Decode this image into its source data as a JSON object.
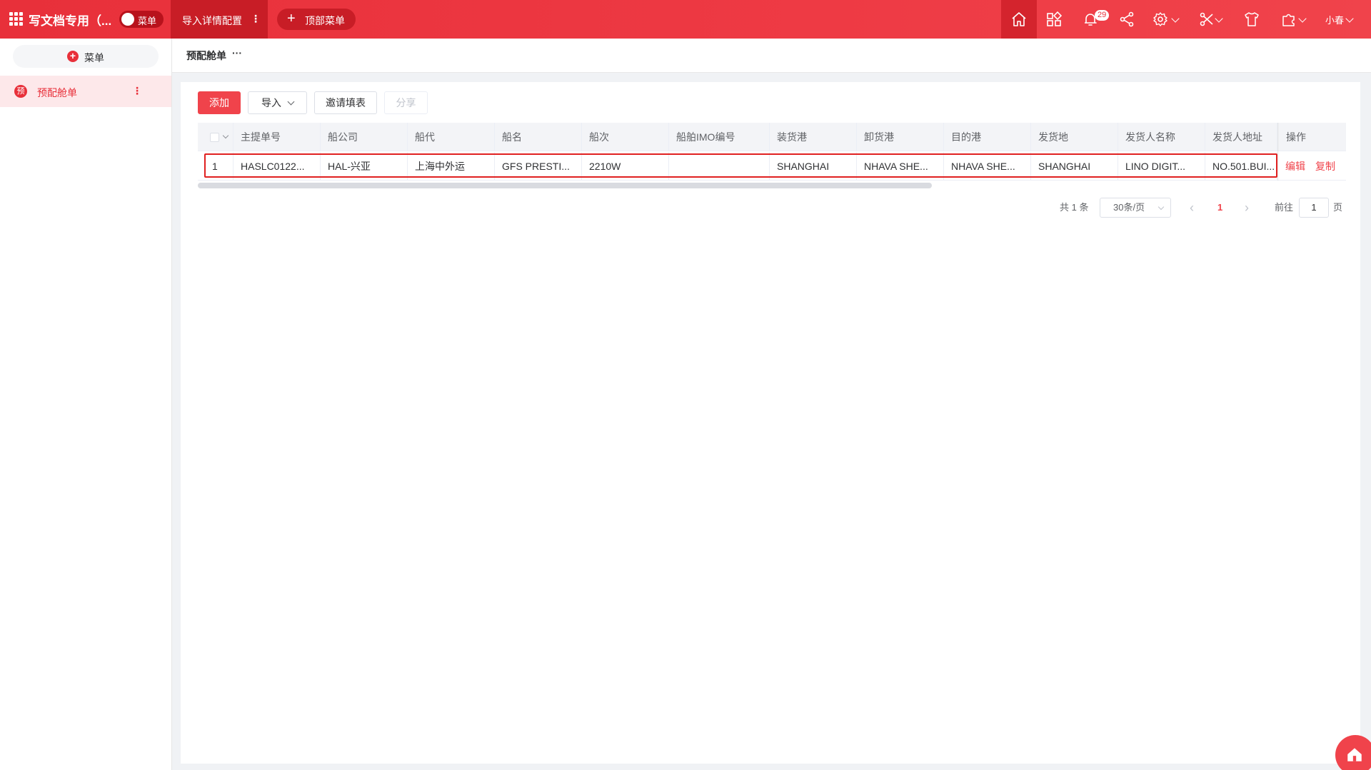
{
  "topbar": {
    "title": "写文档专用（...",
    "toggle_label": "菜单",
    "active_tab": "导入详情配置",
    "tab_more": "⋮",
    "add_top_menu": "顶部菜单",
    "notification_count": "29",
    "user_name": "小春",
    "icons": [
      "home-icon",
      "apps-grid-icon",
      "bell-icon",
      "share-icon",
      "gear-icon",
      "tools-icon",
      "shirt-icon",
      "puzzle-icon"
    ]
  },
  "sidebar": {
    "add_menu_label": "菜单",
    "items": [
      {
        "icon_char": "预",
        "label": "预配舱单",
        "more": "⋮"
      }
    ]
  },
  "breadcrumb": {
    "label": "预配舱单",
    "more": "···"
  },
  "toolbar": {
    "add": "添加",
    "import": "导入",
    "invite": "邀请填表",
    "share": "分享"
  },
  "table": {
    "columns": [
      "主提单号",
      "船公司",
      "船代",
      "船名",
      "船次",
      "船舶IMO编号",
      "装货港",
      "卸货港",
      "目的港",
      "发货地",
      "发货人名称",
      "发货人地址",
      "操作"
    ],
    "rows": [
      {
        "index": "1",
        "cells": [
          "HASLC0122...",
          "HAL-兴亚",
          "上海中外运",
          "GFS PRESTI...",
          "2210W",
          "",
          "SHANGHAI",
          "NHAVA SHE...",
          "NHAVA SHE...",
          "SHANGHAI",
          "LINO DIGIT...",
          "NO.501.BUI..."
        ],
        "actions": [
          "编辑",
          "复制"
        ]
      }
    ]
  },
  "pagination": {
    "total": "共 1 条",
    "page_size": "30条/页",
    "prev": "‹",
    "current": "1",
    "next": "›",
    "goto_label": "前往",
    "goto_value": "1",
    "page_suffix": "页"
  },
  "colors": {
    "brand": "#e8303a",
    "primary_button": "#f0434b",
    "highlight_border": "#e02020"
  }
}
